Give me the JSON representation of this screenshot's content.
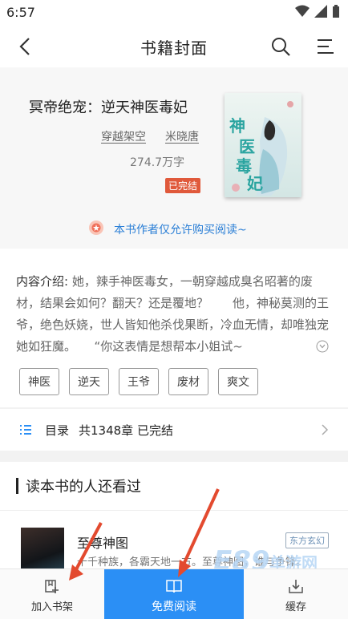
{
  "status": {
    "time": "6:57"
  },
  "nav": {
    "title": "书籍封面"
  },
  "book": {
    "title": "冥帝绝宠：逆天神医毒妃",
    "category": "穿越架空",
    "author": "米晓唐",
    "words": "274.7万字",
    "status_badge": "已完结",
    "cover_title": "神医毒妃"
  },
  "notice": "本书作者仅允许购买阅读~",
  "intro": {
    "label": "内容介绍:",
    "text": " 她，辣手神医毒女，一朝穿越成臭名昭著的废材，结果会如何？翻天？还是覆地？　　他，神秘莫测的王爷，绝色妖娆，世人皆知他杀伐果断，冷血无情，却唯独宠她如狂魔。　　“你这表情是想帮本小姐试~"
  },
  "tags": [
    "神医",
    "逆天",
    "王爷",
    "废材",
    "爽文"
  ],
  "catalog": {
    "label": "目录",
    "info": "共1348章 已完结"
  },
  "also": {
    "title": "读本书的人还看过",
    "items": [
      {
        "title": "至尊神图",
        "desc": "十千种族，各霸天地一方。至尊神图，谁与争锋。",
        "tag": "东方玄幻"
      }
    ]
  },
  "bottom": {
    "add_shelf": "加入书架",
    "read_free": "免费阅读",
    "cache": "缓存"
  },
  "watermark": {
    "logo": "E89",
    "site": "单游网"
  },
  "colors": {
    "accent": "#2b8ff5",
    "badge": "#e0593b",
    "link": "#2b7fd6"
  }
}
